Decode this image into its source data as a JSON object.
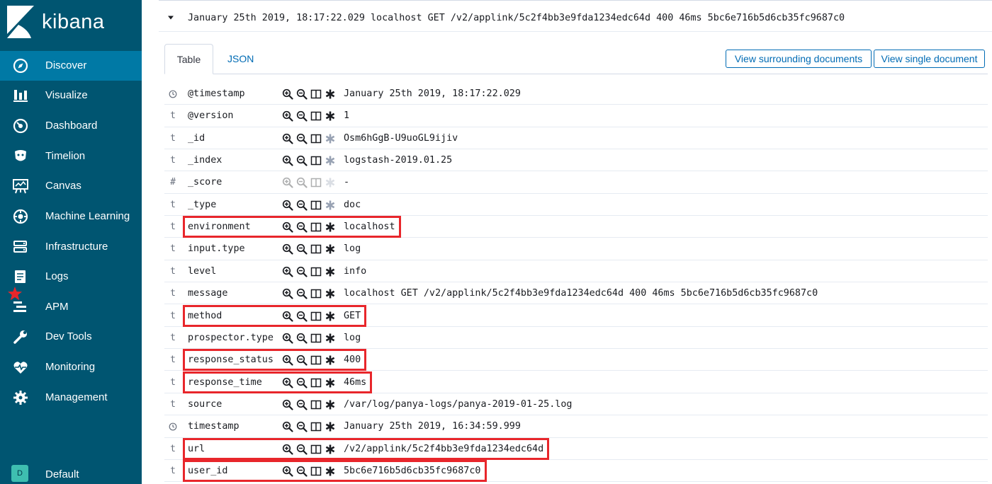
{
  "brand": {
    "name": "kibana"
  },
  "nav": {
    "items": [
      {
        "label": "Discover",
        "icon": "compass-icon",
        "active": true
      },
      {
        "label": "Visualize",
        "icon": "bar-chart-icon",
        "active": false
      },
      {
        "label": "Dashboard",
        "icon": "dashboard-gauge-icon",
        "active": false
      },
      {
        "label": "Timelion",
        "icon": "timelion-icon",
        "active": false
      },
      {
        "label": "Canvas",
        "icon": "canvas-icon",
        "active": false
      },
      {
        "label": "Machine Learning",
        "icon": "machine-learning-icon",
        "active": false
      },
      {
        "label": "Infrastructure",
        "icon": "infrastructure-icon",
        "active": false
      },
      {
        "label": "Logs",
        "icon": "logs-icon",
        "active": false
      },
      {
        "label": "APM",
        "icon": "apm-icon",
        "active": false
      },
      {
        "label": "Dev Tools",
        "icon": "wrench-icon",
        "active": false
      },
      {
        "label": "Monitoring",
        "icon": "heartbeat-icon",
        "active": false
      },
      {
        "label": "Management",
        "icon": "gear-icon",
        "active": false
      }
    ],
    "space": {
      "avatar_letter": "D",
      "label": "Default"
    }
  },
  "document": {
    "summary": "January 25th 2019, 18:17:22.029  localhost GET /v2/applink/5c2f4bb3e9fda1234edc64d 400 46ms 5bc6e716b5d6cb35fc9687c0",
    "tabs": {
      "table": "Table",
      "json": "JSON"
    },
    "buttons": {
      "surrounding": "View surrounding documents",
      "single": "View single document"
    },
    "fields": [
      {
        "type": "clock",
        "name": "@timestamp",
        "value": "January 25th 2019, 18:17:22.029",
        "highlighted": false
      },
      {
        "type": "t",
        "name": "@version",
        "value": "1",
        "highlighted": false
      },
      {
        "type": "t",
        "name": "_id",
        "value": "Osm6hGgB-U9uoGL9ijiv",
        "highlighted": false
      },
      {
        "type": "t",
        "name": "_index",
        "value": "logstash-2019.01.25",
        "highlighted": false
      },
      {
        "type": "#",
        "name": "_score",
        "value": " -",
        "highlighted": false
      },
      {
        "type": "t",
        "name": "_type",
        "value": "doc",
        "highlighted": false
      },
      {
        "type": "t",
        "name": "environment",
        "value": "localhost",
        "highlighted": true
      },
      {
        "type": "t",
        "name": "input.type",
        "value": "log",
        "highlighted": false
      },
      {
        "type": "t",
        "name": "level",
        "value": "info",
        "highlighted": false
      },
      {
        "type": "t",
        "name": "message",
        "value": "localhost GET /v2/applink/5c2f4bb3e9fda1234edc64d 400 46ms 5bc6e716b5d6cb35fc9687c0",
        "highlighted": false,
        "starred": true
      },
      {
        "type": "t",
        "name": "method",
        "value": "GET",
        "highlighted": true
      },
      {
        "type": "t",
        "name": "prospector.type",
        "value": "log",
        "highlighted": false
      },
      {
        "type": "t",
        "name": "response_status",
        "value": "400",
        "highlighted": true
      },
      {
        "type": "t",
        "name": "response_time",
        "value": "46ms",
        "highlighted": true
      },
      {
        "type": "t",
        "name": "source",
        "value": "/var/log/panya-logs/panya-2019-01-25.log",
        "highlighted": false
      },
      {
        "type": "clock",
        "name": "timestamp",
        "value": "January 25th 2019, 16:34:59.999",
        "highlighted": false
      },
      {
        "type": "t",
        "name": "url",
        "value": "/v2/applink/5c2f4bb3e9fda1234edc64d",
        "highlighted": true
      },
      {
        "type": "t",
        "name": "user_id",
        "value": "5bc6e716b5d6cb35fc9687c0",
        "highlighted": true
      }
    ]
  },
  "colors": {
    "sidebar": "#005571",
    "sidebar_active": "#0079a5",
    "link": "#006bb4",
    "highlight_box": "#e8262b"
  }
}
